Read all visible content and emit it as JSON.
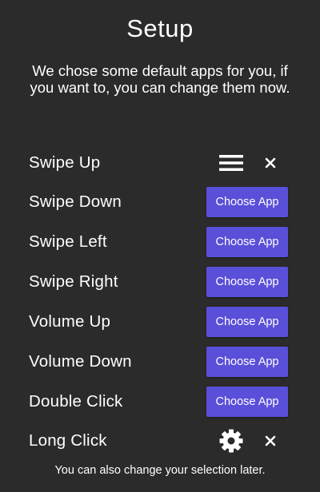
{
  "title": "Setup",
  "subtitle": "We chose some default apps for you, if you want to, you can change them now.",
  "rows": [
    {
      "label": "Swipe Up",
      "type": "assigned",
      "icon": "menu-icon"
    },
    {
      "label": "Swipe Down",
      "type": "button",
      "button": "Choose App"
    },
    {
      "label": "Swipe Left",
      "type": "button",
      "button": "Choose App"
    },
    {
      "label": "Swipe Right",
      "type": "button",
      "button": "Choose App"
    },
    {
      "label": "Volume Up",
      "type": "button",
      "button": "Choose App"
    },
    {
      "label": "Volume Down",
      "type": "button",
      "button": "Choose App"
    },
    {
      "label": "Double Click",
      "type": "button",
      "button": "Choose App"
    },
    {
      "label": "Long Click",
      "type": "assigned",
      "icon": "settings-gear-icon"
    }
  ],
  "footer": "You can also change your selection later.",
  "colors": {
    "background": "#2b2b2b",
    "accent": "#5a4fd8",
    "text": "#ffffff"
  }
}
